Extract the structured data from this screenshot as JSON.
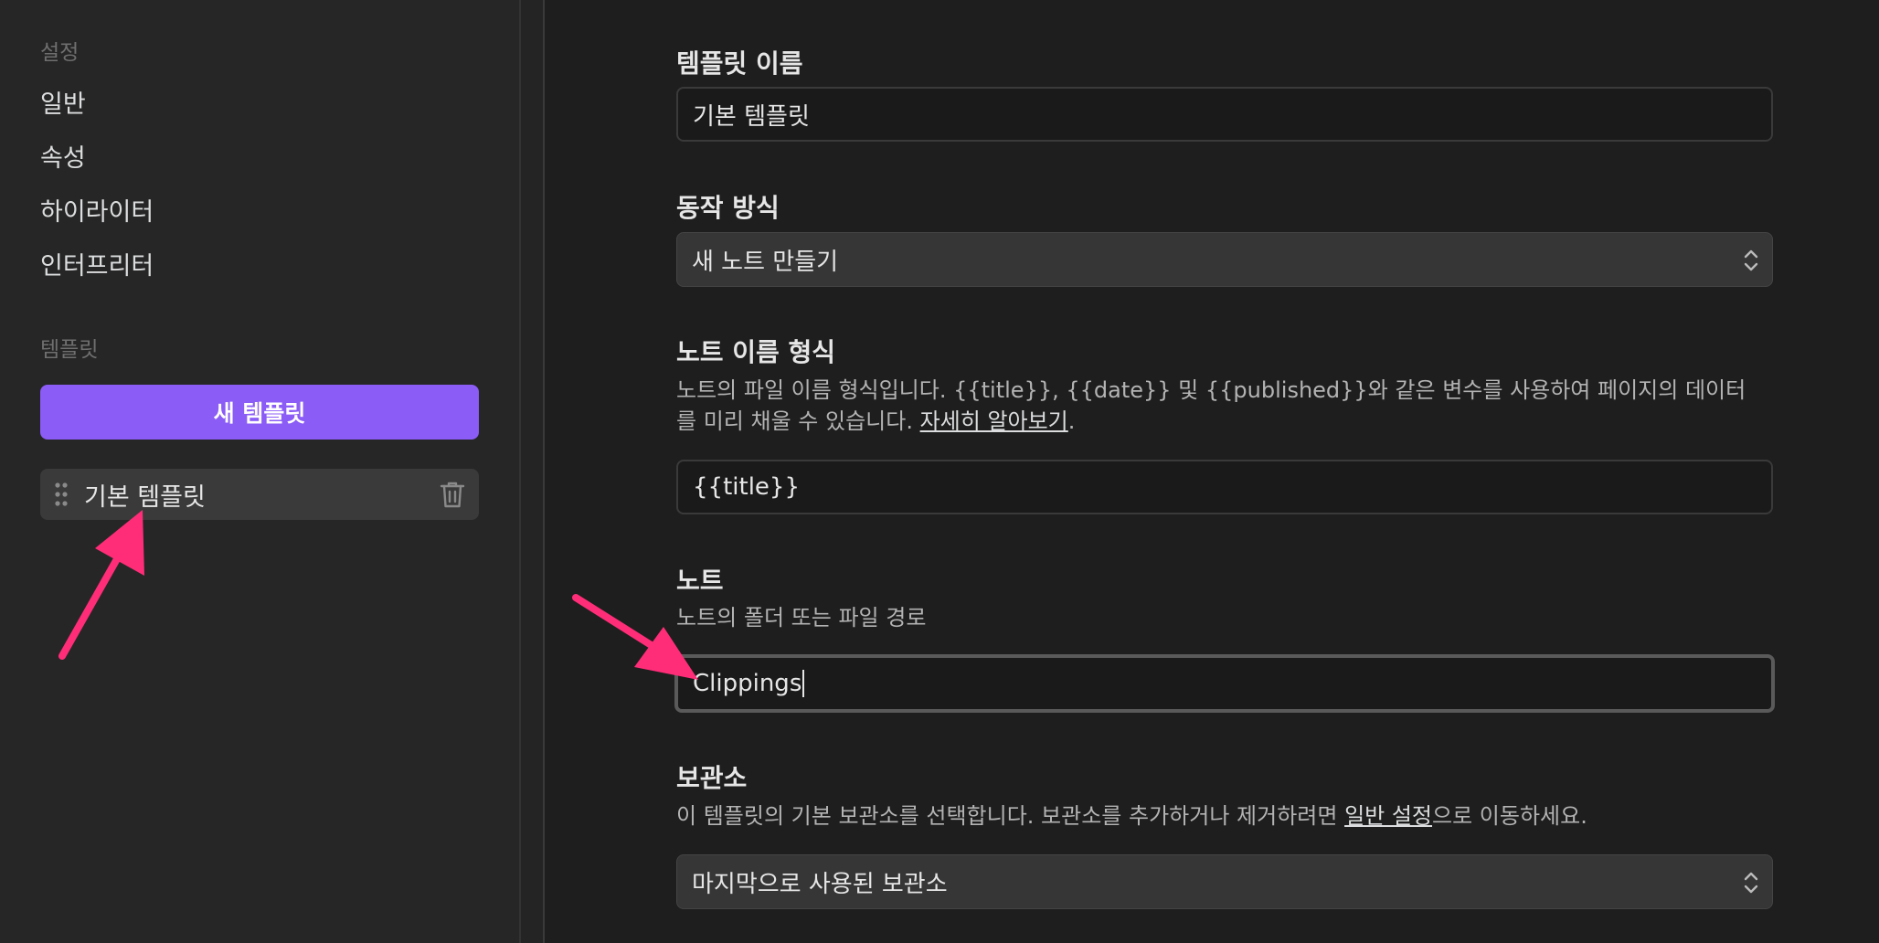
{
  "sidebar": {
    "settings_label": "설정",
    "nav": [
      {
        "label": "일반"
      },
      {
        "label": "속성"
      },
      {
        "label": "하이라이터"
      },
      {
        "label": "인터프리터"
      }
    ],
    "templates_label": "템플릿",
    "new_template_button": "새 템플릿",
    "templates": [
      {
        "name": "기본 템플릿"
      }
    ]
  },
  "main": {
    "template_name": {
      "title": "템플릿 이름",
      "value": "기본 템플릿"
    },
    "behavior": {
      "title": "동작 방식",
      "selected": "새 노트 만들기"
    },
    "note_name_format": {
      "title": "노트 이름 형식",
      "description": "노트의 파일 이름 형식입니다. {{title}}, {{date}} 및 {{published}}와 같은 변수를 사용하여 페이지의 데이터를 미리 채울 수 있습니다. ",
      "link": "자세히 알아보기",
      "description_end": ".",
      "value": "{{title}}"
    },
    "note": {
      "title": "노트",
      "description": "노트의 폴더 또는 파일 경로",
      "value": "Clippings"
    },
    "vault": {
      "title": "보관소",
      "description": "이 템플릿의 기본 보관소를 선택합니다. 보관소를 추가하거나 제거하려면 ",
      "link": "일반 설정",
      "description_end": "으로 이동하세요.",
      "selected": "마지막으로 사용된 보관소"
    }
  },
  "colors": {
    "accent": "#8b5cf6",
    "annotation_arrow": "#ff2d78"
  }
}
